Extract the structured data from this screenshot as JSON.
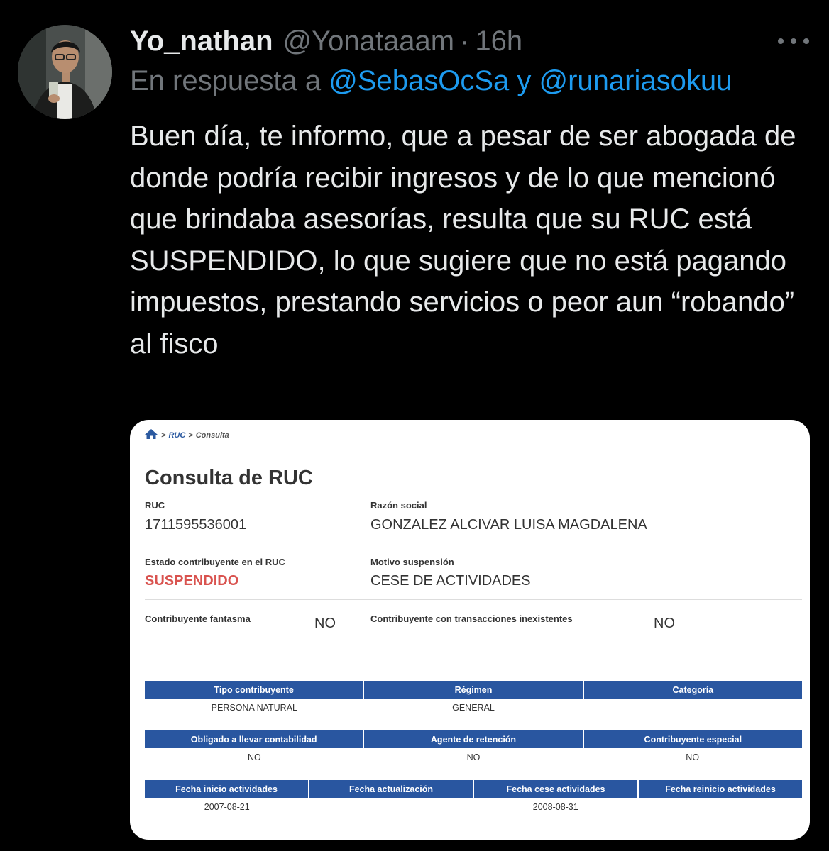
{
  "tweet": {
    "author_name": "Yo_nathan",
    "handle": "@Yonataaam",
    "separator": "·",
    "time": "16h",
    "reply_prefix": "En respuesta a",
    "reply_mention_1": "@SebasOcSa",
    "reply_joiner": "y",
    "reply_mention_2": "@runariasokuu",
    "text": "Buen día, te informo, que a pesar de ser abogada de donde podría recibir ingresos y de lo que mencionó que brindaba asesorías, resulta que su RUC está SUSPENDIDO, lo que sugiere que no está pagando impuestos, prestando servicios o peor aun “robando” al fisco",
    "more_icon": "ellipsis-icon",
    "accent_color": "#1d9bf0"
  },
  "ruc_card": {
    "breadcrumb": {
      "home_icon": "home-icon",
      "sep": ">",
      "link": "RUC",
      "current": "Consulta"
    },
    "title": "Consulta de RUC",
    "ruc_label": "RUC",
    "ruc_value": "1711595536001",
    "razon_label": "Razón social",
    "razon_value": "GONZALEZ ALCIVAR LUISA MAGDALENA",
    "estado_label": "Estado contribuyente en el RUC",
    "estado_value": "SUSPENDIDO",
    "motivo_label": "Motivo suspensión",
    "motivo_value": "CESE DE ACTIVIDADES",
    "fantasma_label": "Contribuyente fantasma",
    "fantasma_value": "NO",
    "trans_label": "Contribuyente con transacciones inexistentes",
    "trans_value": "NO",
    "table1": {
      "headers": [
        "Tipo contribuyente",
        "Régimen",
        "Categoría"
      ],
      "values": [
        "PERSONA NATURAL",
        "GENERAL",
        ""
      ]
    },
    "table2": {
      "headers": [
        "Obligado a llevar contabilidad",
        "Agente de retención",
        "Contribuyente especial"
      ],
      "values": [
        "NO",
        "NO",
        "NO"
      ]
    },
    "table3": {
      "headers": [
        "Fecha inicio actividades",
        "Fecha actualización",
        "Fecha cese actividades",
        "Fecha reinicio actividades"
      ],
      "values": [
        "2007-08-21",
        "",
        "2008-08-31",
        ""
      ]
    },
    "header_color": "#2956a0",
    "suspended_color": "#d9534f"
  }
}
